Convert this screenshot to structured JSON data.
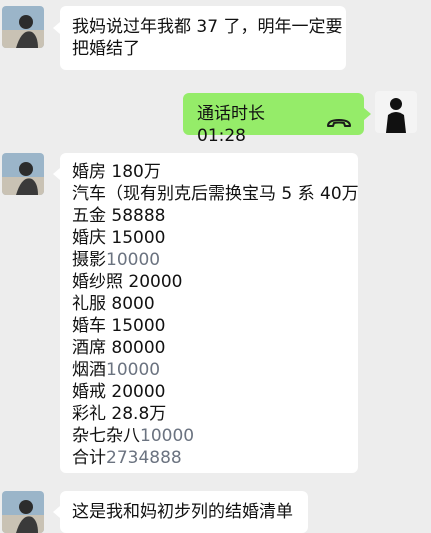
{
  "messages": [
    {
      "side": "left",
      "lines": [
        "我妈说过年我都 37 了，明年一定要",
        "把婚结了"
      ]
    },
    {
      "side": "right",
      "call_label": "通话时长 01:28",
      "icon": "phone-hangup-icon"
    },
    {
      "side": "left",
      "items": [
        {
          "label": "婚房 180万",
          "value": ""
        },
        {
          "label": "汽车（现有别克后需换宝马 5 系 40万",
          "value": ""
        },
        {
          "label": "五金 58888",
          "value": ""
        },
        {
          "label": "婚庆 15000",
          "value": ""
        },
        {
          "label": "摄影",
          "value": "10000"
        },
        {
          "label": "婚纱照 20000",
          "value": ""
        },
        {
          "label": "礼服 8000",
          "value": ""
        },
        {
          "label": "婚车 15000",
          "value": ""
        },
        {
          "label": "酒席 80000",
          "value": ""
        },
        {
          "label": "烟酒",
          "value": "10000"
        },
        {
          "label": "婚戒 20000",
          "value": ""
        },
        {
          "label": "彩礼 28.8万",
          "value": ""
        },
        {
          "label": "杂七杂八",
          "value": "10000"
        },
        {
          "label": "合计",
          "value": "2734888"
        }
      ]
    },
    {
      "side": "left",
      "lines": [
        "这是我和妈初步列的结婚清单"
      ]
    }
  ],
  "colors": {
    "background": "#ededed",
    "left_bubble": "#ffffff",
    "right_bubble": "#95ec69",
    "muted_number": "#6b7380"
  }
}
